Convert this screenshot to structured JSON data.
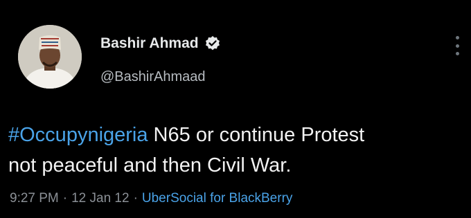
{
  "author": {
    "name": "Bashir Ahmad",
    "handle": "@BashirAhmaad",
    "verified": true
  },
  "tweet": {
    "hashtag": "#Occupynigeria",
    "text_line1_rest": " N65 or continue Protest",
    "text_line2": "not peaceful and then Civil War."
  },
  "meta": {
    "time": "9:27 PM",
    "separator": "·",
    "date": "12 Jan 12",
    "source": "UberSocial for BlackBerry"
  },
  "icons": {
    "verified": "verified-badge-icon",
    "more": "more-vertical-icon"
  },
  "colors": {
    "background": "#000000",
    "link": "#4aa3e8",
    "muted": "#8b9096"
  }
}
